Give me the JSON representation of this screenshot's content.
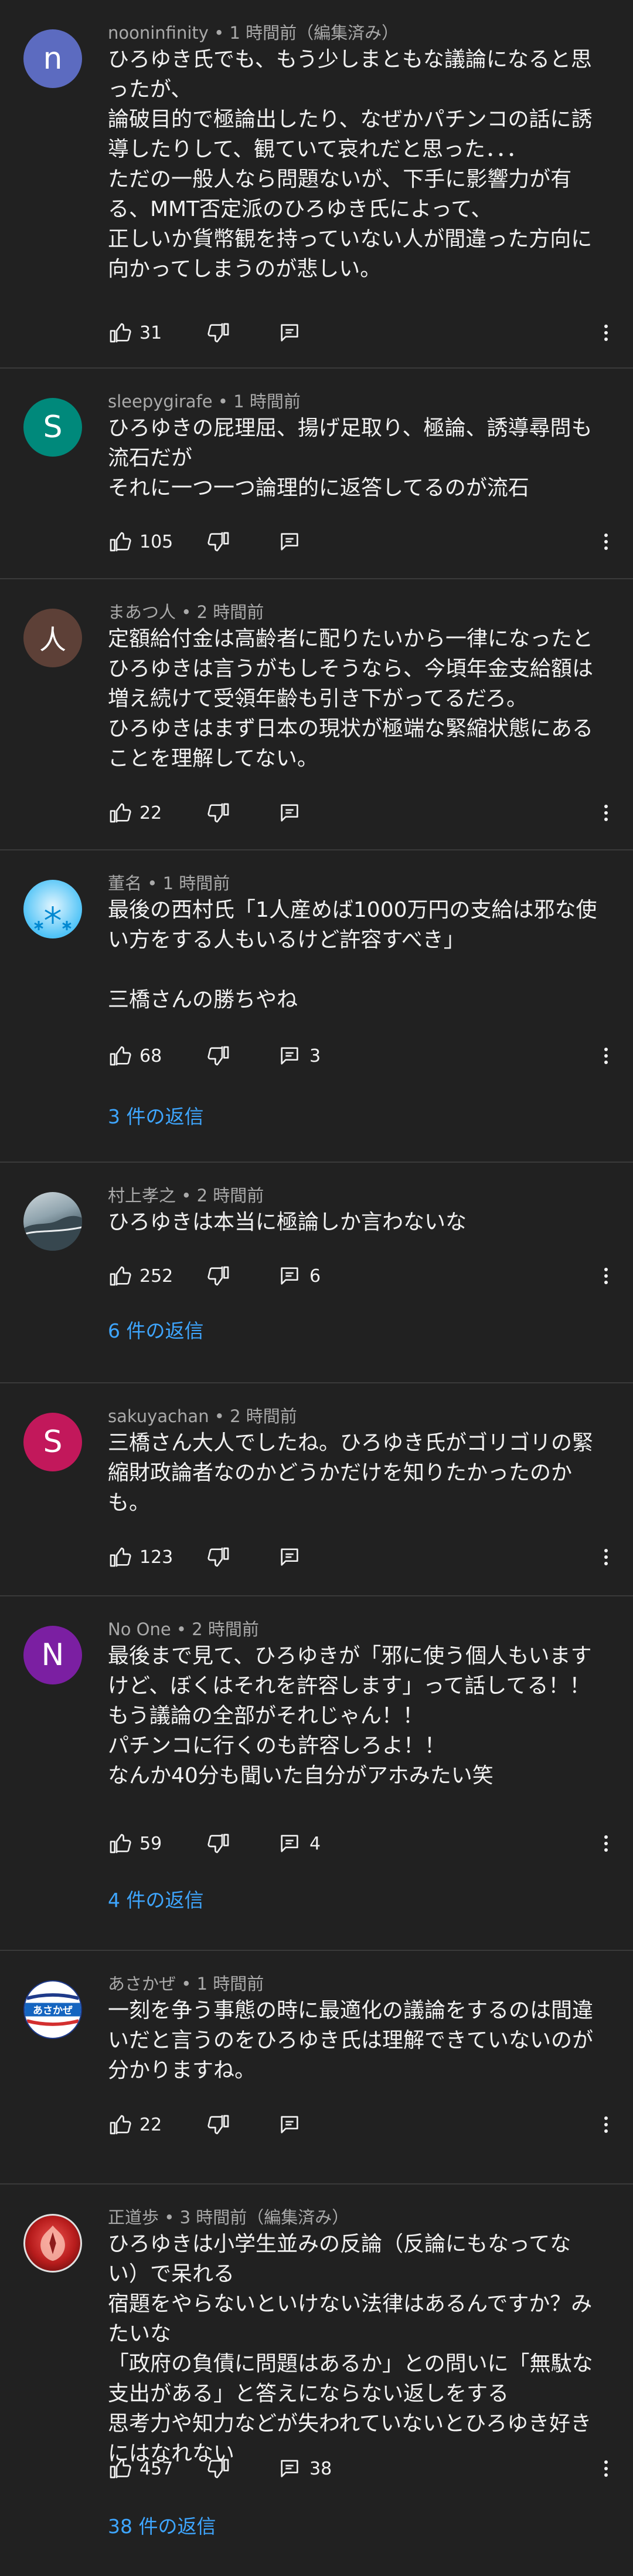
{
  "comments": [
    {
      "author": "nooninfinity",
      "time": "1 時間前（編集済み）",
      "avatar": {
        "letter": "n",
        "color": "#5c6bc0",
        "style": "letter"
      },
      "text": "ひろゆき氏でも、もう少しまともな議論になると思ったが、\n論破目的で極論出したり、なぜかパチンコの話に誘導したりして、観ていて哀れだと思った．．．\nただの一般人なら問題ないが、下手に影響力が有る、MMT否定派のひろゆき氏によって、\n正しいか貨幣観を持っていない人が間違った方向に向かってしまうのが悲しい。",
      "likes": "31",
      "reply_count": "",
      "replies_label": ""
    },
    {
      "author": "sleepygirafe",
      "time": "1 時間前",
      "avatar": {
        "letter": "S",
        "color": "#00897b",
        "style": "letter"
      },
      "text": "ひろゆきの屁理屈、揚げ足取り、極論、誘導尋問も流石だが\nそれに一つ一つ論理的に返答してるのが流石",
      "likes": "105",
      "reply_count": "",
      "replies_label": ""
    },
    {
      "author": "まあつ人",
      "time": "2 時間前",
      "avatar": {
        "letter": "人",
        "color": "#5d4037",
        "style": "letter"
      },
      "text": "定額給付金は高齢者に配りたいから一律になったとひろゆきは言うがもしそうなら、今頃年金支給額は増え続けて受領年齢も引き下がってるだろ。\nひろゆきはまず日本の現状が極端な緊縮状態にあることを理解してない。",
      "likes": "22",
      "reply_count": "",
      "replies_label": ""
    },
    {
      "author": "董名",
      "time": "1 時間前",
      "avatar": {
        "letter": "❄",
        "color": "#4fc3f7",
        "style": "snow"
      },
      "text": "最後の西村氏「1人産めば1000万円の支給は邪な使い方をする人もいるけど許容すべき」\n\n三橋さんの勝ちやね",
      "likes": "68",
      "reply_count": "3",
      "replies_label": "3 件の返信"
    },
    {
      "author": "村上孝之",
      "time": "2 時間前",
      "avatar": {
        "letter": "",
        "color": "#9e9e9e",
        "style": "photo"
      },
      "text": "ひろゆきは本当に極論しか言わないな",
      "likes": "252",
      "reply_count": "6",
      "replies_label": "6 件の返信"
    },
    {
      "author": "sakuyachan",
      "time": "2 時間前",
      "avatar": {
        "letter": "S",
        "color": "#c2185b",
        "style": "letter"
      },
      "text": "三橋さん大人でしたね。ひろゆき氏がゴリゴリの緊縮財政論者なのかどうかだけを知りたかったのかも。",
      "likes": "123",
      "reply_count": "",
      "replies_label": ""
    },
    {
      "author": "No One",
      "time": "2 時間前",
      "avatar": {
        "letter": "N",
        "color": "#7b1fa2",
        "style": "letter"
      },
      "text": "最後まで見て、ひろゆきが「邪に使う個人もいますけど、ぼくはそれを許容します」って話してる！！\nもう議論の全部がそれじゃん！！\nパチンコに行くのも許容しろよ！！\nなんか40分も聞いた自分がアホみたい笑",
      "likes": "59",
      "reply_count": "4",
      "replies_label": "4 件の返信"
    },
    {
      "author": "あさかぜ",
      "time": "1 時間前",
      "avatar": {
        "letter": "あさかぜ",
        "color": "#ffffff",
        "style": "logo"
      },
      "text": "一刻を争う事態の時に最適化の議論をするのは間違いだと言うのをひろゆき氏は理解できていないのが分かりますね。",
      "likes": "22",
      "reply_count": "",
      "replies_label": ""
    },
    {
      "author": "正道歩",
      "time": "3 時間前（編集済み）",
      "avatar": {
        "letter": "",
        "color": "#b71c1c",
        "style": "emblem"
      },
      "text": "ひろゆきは小学生並みの反論（反論にもなってない）で呆れる\n宿題をやらないといけない法律はあるんですか？みたいな\n「政府の負債に問題はあるか」との問いに「無駄な支出がある」と答えにならない返しをする\n思考力や知力などが失われていないとひろゆき好きにはなれない",
      "likes": "457",
      "reply_count": "38",
      "replies_label": "38 件の返信"
    }
  ]
}
